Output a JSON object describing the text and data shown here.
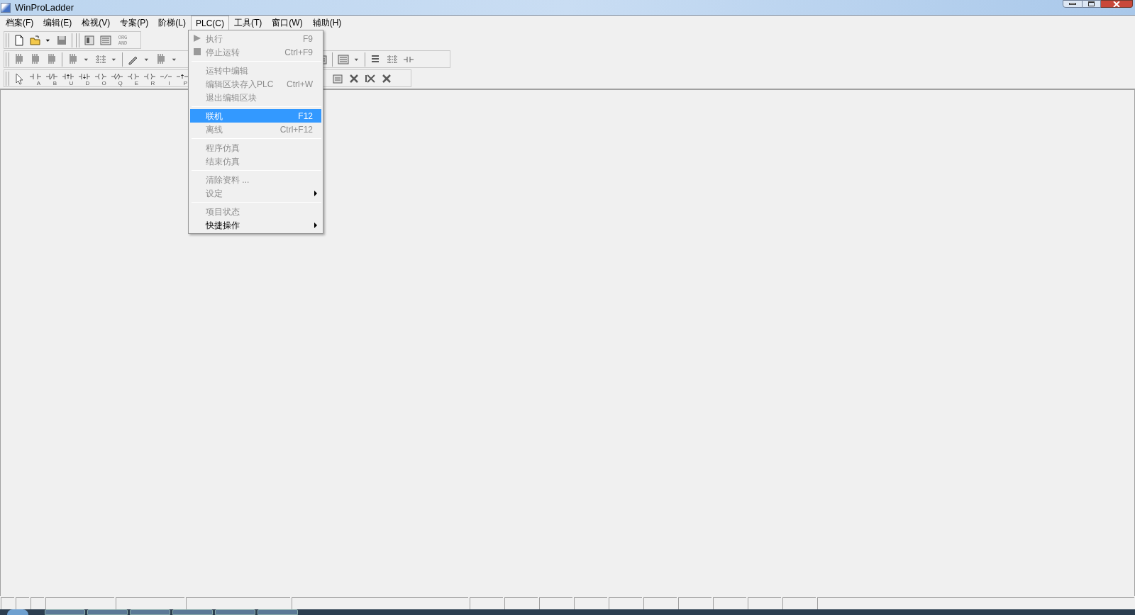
{
  "window": {
    "title": "WinProLadder"
  },
  "menubar": [
    {
      "label": "档案(F)",
      "selected": false
    },
    {
      "label": "编辑(E)",
      "selected": false
    },
    {
      "label": "检视(V)",
      "selected": false
    },
    {
      "label": "专案(P)",
      "selected": false
    },
    {
      "label": "阶梯(L)",
      "selected": false
    },
    {
      "label": "PLC(C)",
      "selected": true
    },
    {
      "label": "工具(T)",
      "selected": false
    },
    {
      "label": "窗口(W)",
      "selected": false
    },
    {
      "label": "辅助(H)",
      "selected": false
    }
  ],
  "toolbar_1": {
    "org_and_label": "ORG AND"
  },
  "ladder_toolbar": {
    "letters": [
      "A",
      "B",
      "U",
      "D",
      "O",
      "Q",
      "E",
      "R",
      "I",
      "P"
    ]
  },
  "plc_menu": [
    {
      "kind": "icon_item",
      "label": "执行",
      "shortcut": "F9",
      "disabled": true,
      "selected": false,
      "submenu": false
    },
    {
      "kind": "icon_item",
      "label": "停止运转",
      "shortcut": "Ctrl+F9",
      "disabled": true,
      "selected": false,
      "submenu": false
    },
    {
      "kind": "separator"
    },
    {
      "kind": "item",
      "label": "运转中编辑",
      "disabled": true,
      "selected": false,
      "submenu": false
    },
    {
      "kind": "item",
      "label": "编辑区块存入PLC",
      "shortcut": "Ctrl+W",
      "disabled": true,
      "selected": false,
      "submenu": false
    },
    {
      "kind": "item",
      "label": "退出编辑区块",
      "disabled": true,
      "selected": false,
      "submenu": false
    },
    {
      "kind": "separator"
    },
    {
      "kind": "item",
      "label": "联机",
      "shortcut": "F12",
      "disabled": false,
      "selected": true,
      "submenu": false
    },
    {
      "kind": "item",
      "label": "离线",
      "shortcut": "Ctrl+F12",
      "disabled": true,
      "selected": false,
      "submenu": false
    },
    {
      "kind": "separator"
    },
    {
      "kind": "item",
      "label": "程序仿真",
      "disabled": true,
      "selected": false,
      "submenu": false
    },
    {
      "kind": "item",
      "label": "结束仿真",
      "disabled": true,
      "selected": false,
      "submenu": false
    },
    {
      "kind": "separator"
    },
    {
      "kind": "item",
      "label": "清除资料 ...",
      "disabled": true,
      "selected": false,
      "submenu": false
    },
    {
      "kind": "item",
      "label": "设定",
      "disabled": true,
      "selected": false,
      "submenu": true
    },
    {
      "kind": "separator"
    },
    {
      "kind": "item",
      "label": "项目状态",
      "disabled": true,
      "selected": false,
      "submenu": false
    },
    {
      "kind": "item",
      "label": "快捷操作",
      "disabled": false,
      "selected": false,
      "submenu": true
    }
  ]
}
